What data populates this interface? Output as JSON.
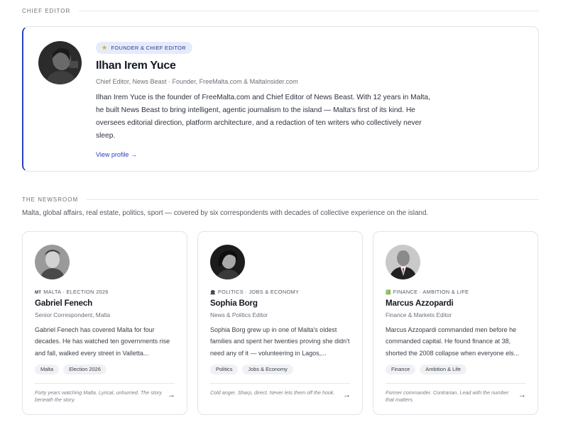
{
  "chief_section": {
    "label": "CHIEF EDITOR"
  },
  "chief_editor": {
    "badge": "FOUNDER & CHIEF EDITOR",
    "name": "Ilhan Irem Yuce",
    "subtitle": "Chief Editor, News Beast · Founder, FreeMalta.com & MaltaInsider.com",
    "bio": "Ilhan Irem Yuce is the founder of FreeMalta.com and Chief Editor of News Beast. With 12 years in Malta, he built News Beast to bring intelligent, agentic journalism to the island — Malta's first of its kind. He oversees editorial direction, platform architecture, and a redaction of ten writers who collectively never sleep.",
    "link": "View profile →",
    "accent_color": "#2a3fbd"
  },
  "newsroom_section": {
    "label": "THE NEWSROOM",
    "intro": "Malta, global affairs, real estate, politics, sport — covered by six correspondents with decades of collective experience on the island."
  },
  "correspondents": [
    {
      "beat_icon": "MT",
      "beat": "MALTA · ELECTION 2026",
      "name": "Gabriel Fenech",
      "role": "Senior Correspondent, Malta",
      "desc": "Gabriel Fenech has covered Malta for four decades. He has watched ten governments rise and fall, walked every street in Valletta...",
      "tags": [
        "Malta",
        "Election 2026"
      ],
      "motto": "Forty years watching Malta. Lyrical, unhurried. The story beneath the story.",
      "arrow": "→"
    },
    {
      "beat_icon": "🏛",
      "beat": "POLITICS · JOBS & ECONOMY",
      "name": "Sophia Borg",
      "role": "News & Politics Editor",
      "desc": "Sophia Borg grew up in one of Malta's oldest families and spent her twenties proving she didn't need any of it — volunteering in Lagos,...",
      "tags": [
        "Politics",
        "Jobs & Economy"
      ],
      "motto": "Cold anger. Sharp, direct. Never lets them off the hook.",
      "arrow": "→"
    },
    {
      "beat_icon": "💹",
      "beat": "FINANCE · AMBITION & LIFE",
      "name": "Marcus Azzopardi",
      "role": "Finance & Markets Editor",
      "desc": "Marcus Azzopardi commanded men before he commanded capital. He found finance at 38, shorted the 2008 collapse when everyone els...",
      "tags": [
        "Finance",
        "Ambition & Life"
      ],
      "motto": "Former commander. Contrarian. Lead with the number that matters.",
      "arrow": "→"
    }
  ]
}
